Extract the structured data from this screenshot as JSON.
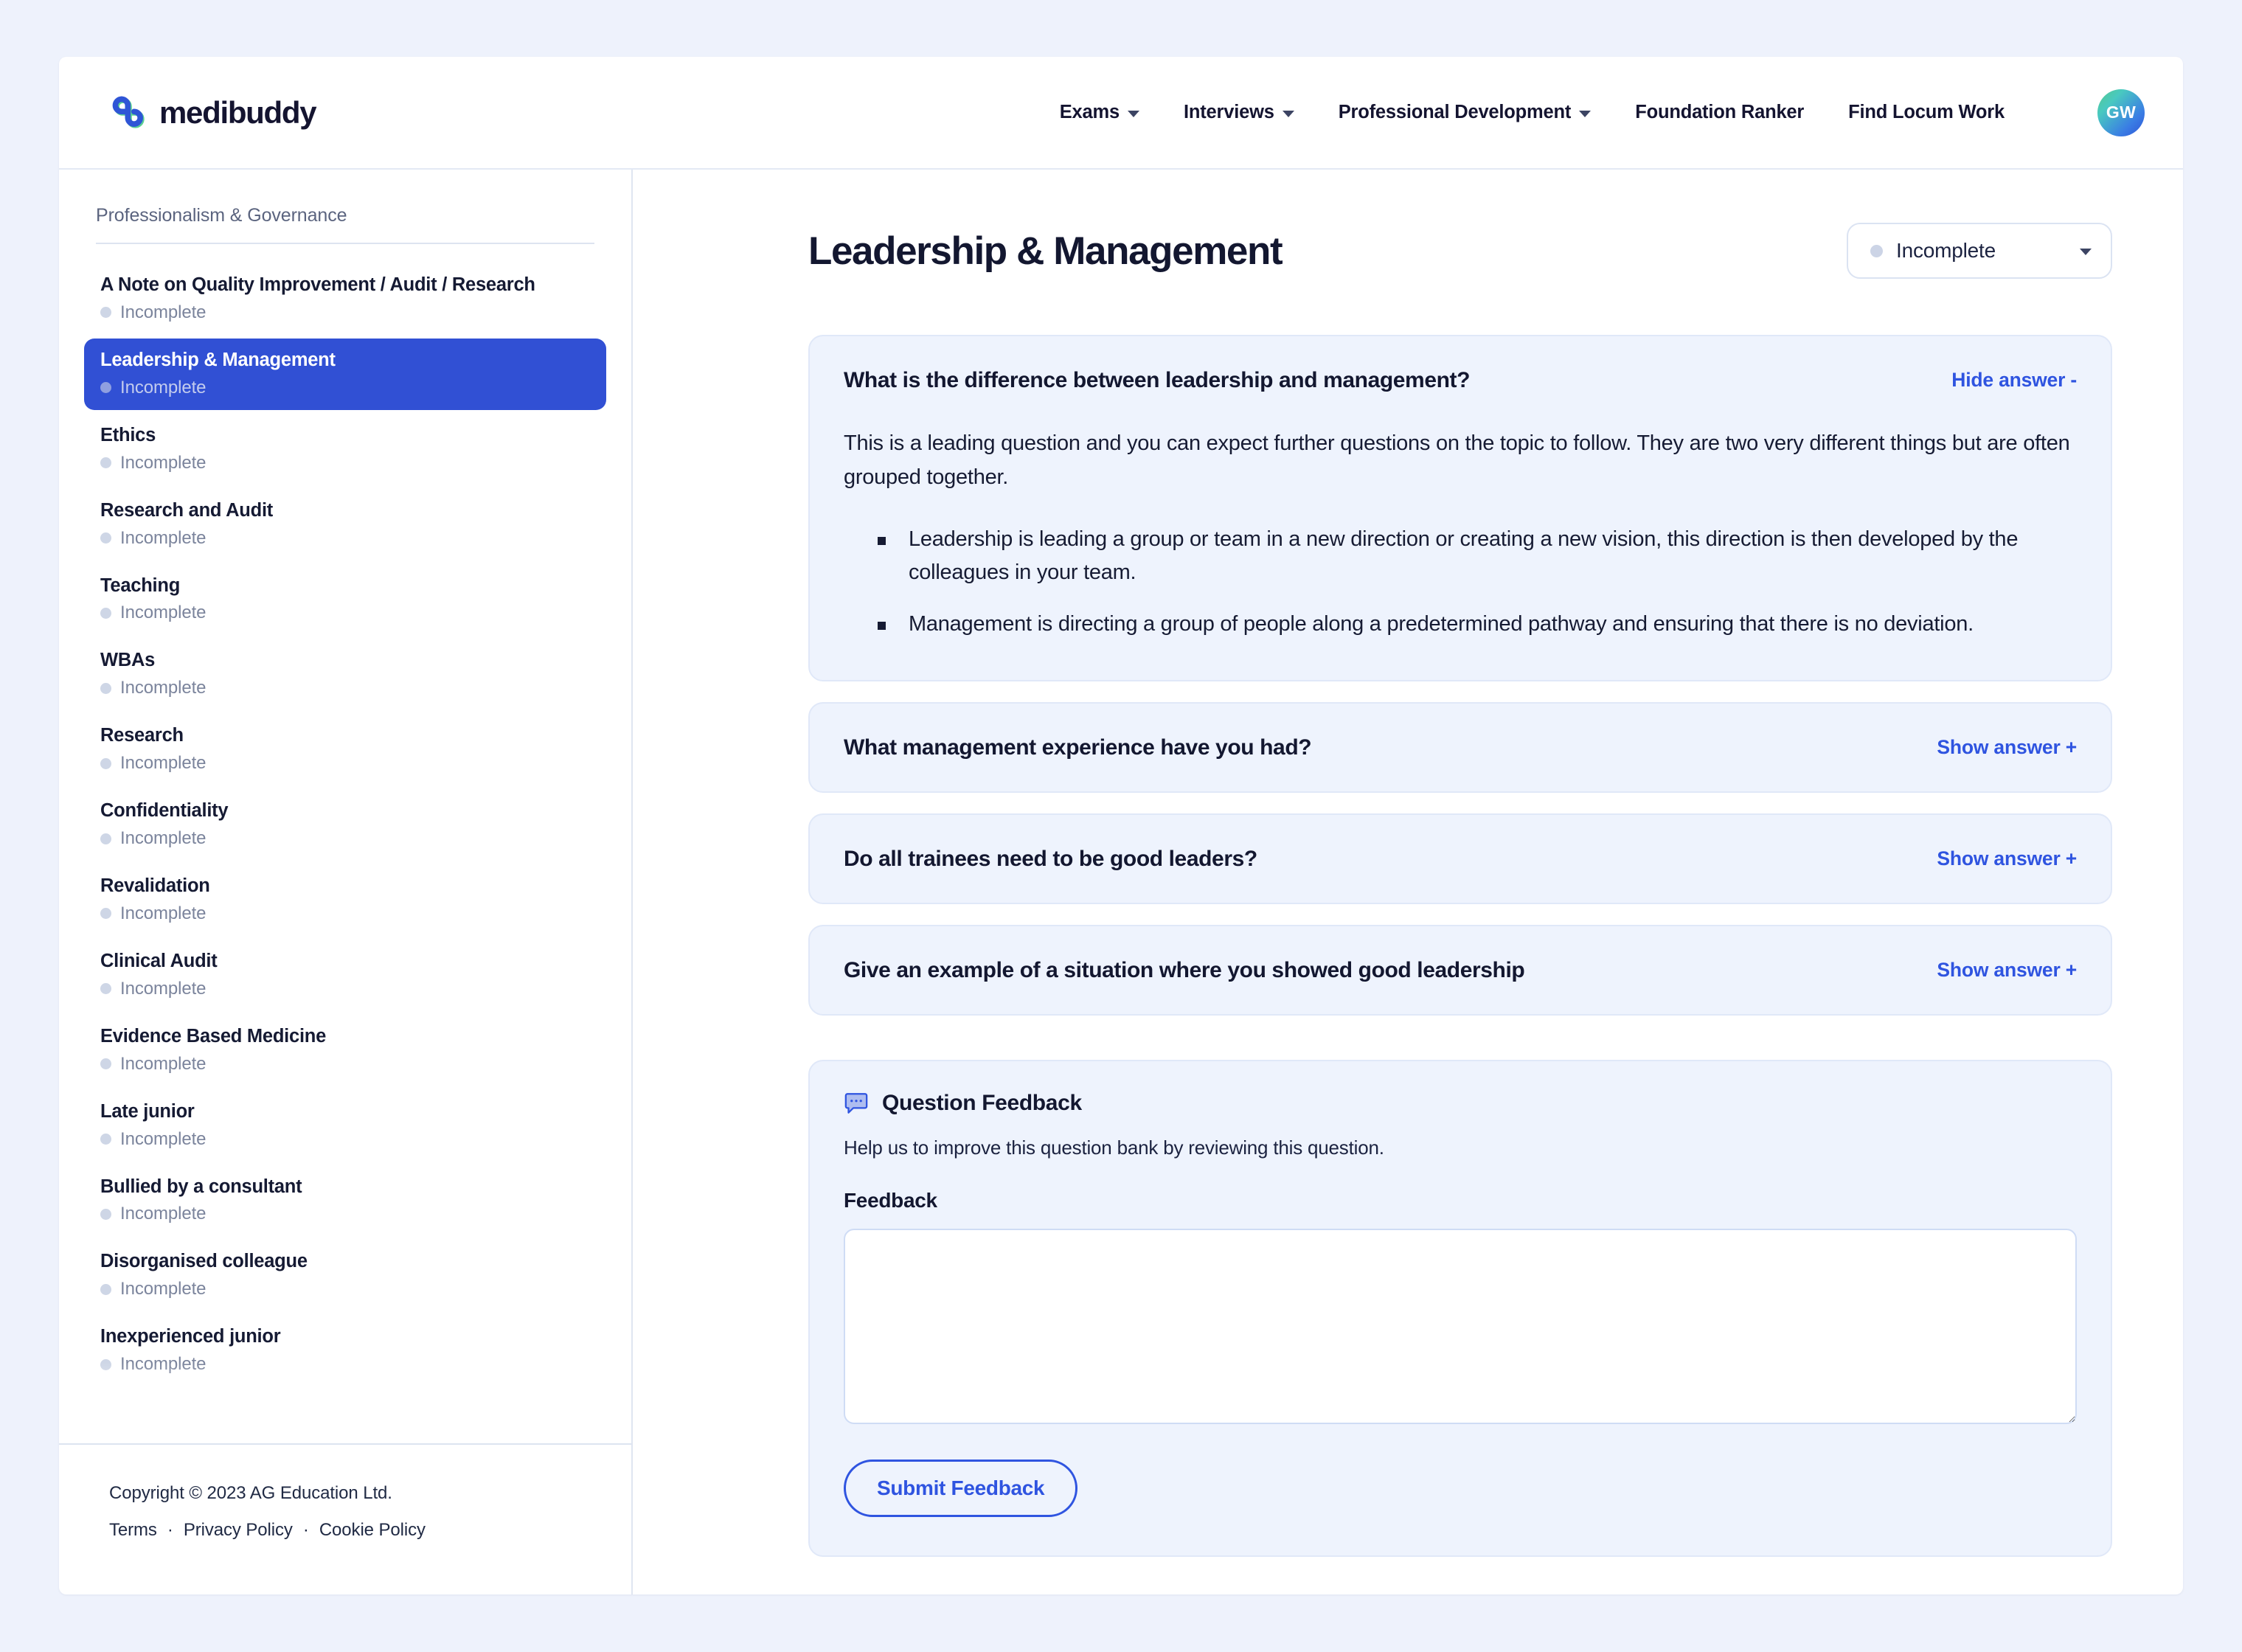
{
  "brand": {
    "name": "medibuddy"
  },
  "header": {
    "nav": [
      {
        "label": "Exams",
        "has_dropdown": true
      },
      {
        "label": "Interviews",
        "has_dropdown": true
      },
      {
        "label": "Professional Development",
        "has_dropdown": true
      },
      {
        "label": "Foundation Ranker",
        "has_dropdown": false
      },
      {
        "label": "Find Locum Work",
        "has_dropdown": false
      }
    ],
    "avatar_initials": "GW"
  },
  "sidebar": {
    "heading": "Professionalism & Governance",
    "items": [
      {
        "title": "A Note on Quality Improvement / Audit / Research",
        "status": "Incomplete",
        "active": false
      },
      {
        "title": "Leadership & Management",
        "status": "Incomplete",
        "active": true
      },
      {
        "title": "Ethics",
        "status": "Incomplete",
        "active": false
      },
      {
        "title": "Research and Audit",
        "status": "Incomplete",
        "active": false
      },
      {
        "title": "Teaching",
        "status": "Incomplete",
        "active": false
      },
      {
        "title": "WBAs",
        "status": "Incomplete",
        "active": false
      },
      {
        "title": "Research",
        "status": "Incomplete",
        "active": false
      },
      {
        "title": "Confidentiality",
        "status": "Incomplete",
        "active": false
      },
      {
        "title": "Revalidation",
        "status": "Incomplete",
        "active": false
      },
      {
        "title": "Clinical Audit",
        "status": "Incomplete",
        "active": false
      },
      {
        "title": "Evidence Based Medicine",
        "status": "Incomplete",
        "active": false
      },
      {
        "title": "Late junior",
        "status": "Incomplete",
        "active": false
      },
      {
        "title": "Bullied by a consultant",
        "status": "Incomplete",
        "active": false
      },
      {
        "title": "Disorganised colleague",
        "status": "Incomplete",
        "active": false
      },
      {
        "title": "Inexperienced junior",
        "status": "Incomplete",
        "active": false
      }
    ],
    "footer": {
      "copyright": "Copyright © 2023 AG Education Ltd.",
      "links": [
        "Terms",
        "Privacy Policy",
        "Cookie Policy"
      ],
      "separator": "·"
    }
  },
  "main": {
    "title": "Leadership & Management",
    "status_select": {
      "value": "Incomplete"
    },
    "questions": [
      {
        "question": "What is the difference between leadership and management?",
        "toggle_label": "Hide answer -",
        "expanded": true,
        "answer_paragraphs": [
          "This is a leading question and you can expect further questions on the topic to follow. They are two very different things but are often grouped together."
        ],
        "answer_bullets": [
          "Leadership is leading a group or team in a new direction or creating a new vision, this direction is then developed by the colleagues in your team.",
          "Management is directing a group of people along a predetermined pathway and ensuring that there is no deviation."
        ]
      },
      {
        "question": "What management experience have you had?",
        "toggle_label": "Show answer +",
        "expanded": false,
        "answer_paragraphs": [],
        "answer_bullets": []
      },
      {
        "question": "Do all trainees need to be good leaders?",
        "toggle_label": "Show answer +",
        "expanded": false,
        "answer_paragraphs": [],
        "answer_bullets": []
      },
      {
        "question": "Give an example of a situation where you showed good leadership",
        "toggle_label": "Show answer +",
        "expanded": false,
        "answer_paragraphs": [],
        "answer_bullets": []
      }
    ],
    "feedback": {
      "title": "Question Feedback",
      "subtitle": "Help us to improve this question bank by reviewing this question.",
      "field_label": "Feedback",
      "textarea_value": "",
      "textarea_placeholder": "",
      "submit_label": "Submit Feedback"
    }
  },
  "colors": {
    "page_background": "#eef2fc",
    "accent_blue": "#2f54e0",
    "active_item": "#3150d4",
    "card_background": "#eef3fd",
    "logo_blue": "#2f55d6",
    "logo_green": "#5bd093",
    "text_dark": "#131730",
    "text_muted": "#7b849c"
  }
}
